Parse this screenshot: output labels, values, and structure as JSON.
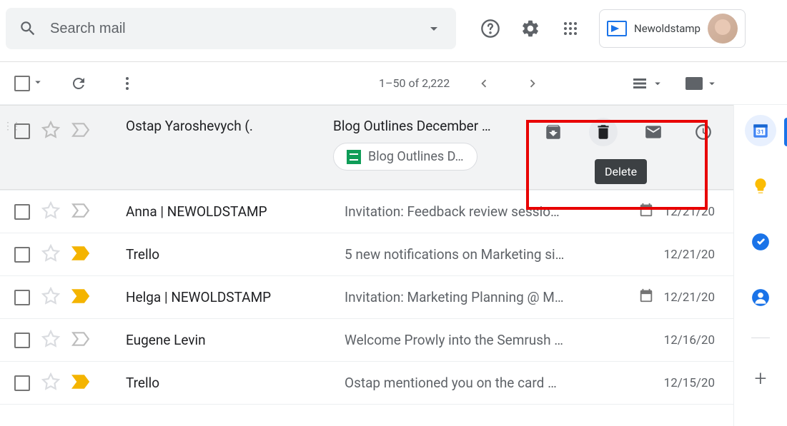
{
  "header": {
    "search_placeholder": "Search mail",
    "brand_label": "Newoldstamp"
  },
  "toolbar": {
    "pagination_text": "1–50 of 2,222"
  },
  "hovered_row": {
    "sender": "Ostap Yaroshevych (.",
    "subject": "Blog Outlines December …",
    "attachment_label": "Blog Outlines D…",
    "tooltip": "Delete"
  },
  "rows": [
    {
      "sender": "Anna | NEWOLDSTAMP",
      "subject": "Invitation: Feedback review sessio…",
      "date": "12/21/20",
      "has_cal": true,
      "important_yellow": false
    },
    {
      "sender": "Trello",
      "subject": "5 new notifications on Marketing si…",
      "date": "12/21/20",
      "has_cal": false,
      "important_yellow": true
    },
    {
      "sender": "Helga | NEWOLDSTAMP",
      "subject": "Invitation: Marketing Planning @ M…",
      "date": "12/21/20",
      "has_cal": true,
      "important_yellow": true
    },
    {
      "sender": "Eugene Levin",
      "subject": "Welcome Prowly into the Semrush …",
      "date": "12/16/20",
      "has_cal": false,
      "important_yellow": false
    },
    {
      "sender": "Trello",
      "subject": "Ostap mentioned you on the card …",
      "date": "12/15/20",
      "has_cal": false,
      "important_yellow": true
    }
  ]
}
